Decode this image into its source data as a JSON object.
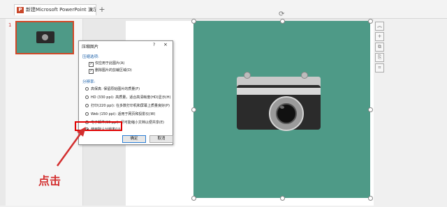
{
  "window": {
    "tab_title": "新建Microsoft PowerPoint 演示文稿",
    "tab_close": "×",
    "new_tab": "+"
  },
  "thumbnail": {
    "slide_number": "1"
  },
  "dialog": {
    "title": "压缩图片",
    "help": "?",
    "close": "×",
    "compression_group": "压缩选项:",
    "opt_apply_only": "仅应用于此图片(A)",
    "opt_delete_cropped": "删除图片的剪裁区域(D)",
    "resolution_group": "分辨率:",
    "resolutions": [
      {
        "label": "高保真: 保留原始图片的质量(F)",
        "selected": false
      },
      {
        "label": "HD (330 ppi): 高质量，适合高清晰度(HD)显示(H)",
        "selected": false
      },
      {
        "label": "打印(220 ppi): 在多数打印机和屏幕上质量良好(P)",
        "selected": false
      },
      {
        "label": "Web (150 ppi): 适用于网页和投影仪(W)",
        "selected": false
      },
      {
        "label": "电子邮件(96 ppi): 尽可能缩小文档以便共享(E)",
        "selected": false
      },
      {
        "label": "使用默认分辨率(U)",
        "selected": true
      }
    ],
    "ok": "确定",
    "cancel": "取消"
  },
  "annotation": {
    "text": "点击",
    "color": "#d32f2f"
  },
  "colors": {
    "accent": "#d24726",
    "photo_bg": "#4e9a87",
    "highlight": "#e00000"
  }
}
